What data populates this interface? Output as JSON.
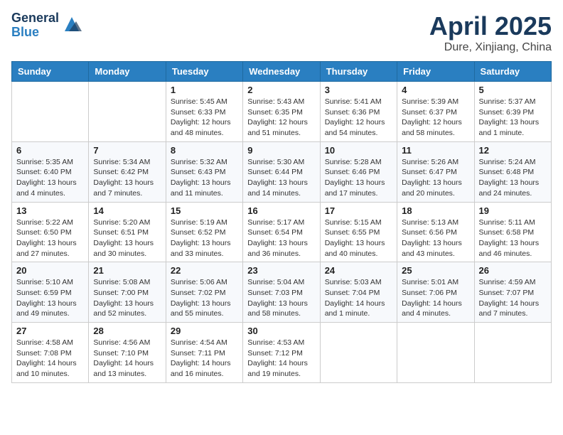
{
  "logo": {
    "general": "General",
    "blue": "Blue"
  },
  "title": "April 2025",
  "location": "Dure, Xinjiang, China",
  "days_of_week": [
    "Sunday",
    "Monday",
    "Tuesday",
    "Wednesday",
    "Thursday",
    "Friday",
    "Saturday"
  ],
  "weeks": [
    [
      {
        "day": "",
        "info": ""
      },
      {
        "day": "",
        "info": ""
      },
      {
        "day": "1",
        "info": "Sunrise: 5:45 AM\nSunset: 6:33 PM\nDaylight: 12 hours and 48 minutes."
      },
      {
        "day": "2",
        "info": "Sunrise: 5:43 AM\nSunset: 6:35 PM\nDaylight: 12 hours and 51 minutes."
      },
      {
        "day": "3",
        "info": "Sunrise: 5:41 AM\nSunset: 6:36 PM\nDaylight: 12 hours and 54 minutes."
      },
      {
        "day": "4",
        "info": "Sunrise: 5:39 AM\nSunset: 6:37 PM\nDaylight: 12 hours and 58 minutes."
      },
      {
        "day": "5",
        "info": "Sunrise: 5:37 AM\nSunset: 6:39 PM\nDaylight: 13 hours and 1 minute."
      }
    ],
    [
      {
        "day": "6",
        "info": "Sunrise: 5:35 AM\nSunset: 6:40 PM\nDaylight: 13 hours and 4 minutes."
      },
      {
        "day": "7",
        "info": "Sunrise: 5:34 AM\nSunset: 6:42 PM\nDaylight: 13 hours and 7 minutes."
      },
      {
        "day": "8",
        "info": "Sunrise: 5:32 AM\nSunset: 6:43 PM\nDaylight: 13 hours and 11 minutes."
      },
      {
        "day": "9",
        "info": "Sunrise: 5:30 AM\nSunset: 6:44 PM\nDaylight: 13 hours and 14 minutes."
      },
      {
        "day": "10",
        "info": "Sunrise: 5:28 AM\nSunset: 6:46 PM\nDaylight: 13 hours and 17 minutes."
      },
      {
        "day": "11",
        "info": "Sunrise: 5:26 AM\nSunset: 6:47 PM\nDaylight: 13 hours and 20 minutes."
      },
      {
        "day": "12",
        "info": "Sunrise: 5:24 AM\nSunset: 6:48 PM\nDaylight: 13 hours and 24 minutes."
      }
    ],
    [
      {
        "day": "13",
        "info": "Sunrise: 5:22 AM\nSunset: 6:50 PM\nDaylight: 13 hours and 27 minutes."
      },
      {
        "day": "14",
        "info": "Sunrise: 5:20 AM\nSunset: 6:51 PM\nDaylight: 13 hours and 30 minutes."
      },
      {
        "day": "15",
        "info": "Sunrise: 5:19 AM\nSunset: 6:52 PM\nDaylight: 13 hours and 33 minutes."
      },
      {
        "day": "16",
        "info": "Sunrise: 5:17 AM\nSunset: 6:54 PM\nDaylight: 13 hours and 36 minutes."
      },
      {
        "day": "17",
        "info": "Sunrise: 5:15 AM\nSunset: 6:55 PM\nDaylight: 13 hours and 40 minutes."
      },
      {
        "day": "18",
        "info": "Sunrise: 5:13 AM\nSunset: 6:56 PM\nDaylight: 13 hours and 43 minutes."
      },
      {
        "day": "19",
        "info": "Sunrise: 5:11 AM\nSunset: 6:58 PM\nDaylight: 13 hours and 46 minutes."
      }
    ],
    [
      {
        "day": "20",
        "info": "Sunrise: 5:10 AM\nSunset: 6:59 PM\nDaylight: 13 hours and 49 minutes."
      },
      {
        "day": "21",
        "info": "Sunrise: 5:08 AM\nSunset: 7:00 PM\nDaylight: 13 hours and 52 minutes."
      },
      {
        "day": "22",
        "info": "Sunrise: 5:06 AM\nSunset: 7:02 PM\nDaylight: 13 hours and 55 minutes."
      },
      {
        "day": "23",
        "info": "Sunrise: 5:04 AM\nSunset: 7:03 PM\nDaylight: 13 hours and 58 minutes."
      },
      {
        "day": "24",
        "info": "Sunrise: 5:03 AM\nSunset: 7:04 PM\nDaylight: 14 hours and 1 minute."
      },
      {
        "day": "25",
        "info": "Sunrise: 5:01 AM\nSunset: 7:06 PM\nDaylight: 14 hours and 4 minutes."
      },
      {
        "day": "26",
        "info": "Sunrise: 4:59 AM\nSunset: 7:07 PM\nDaylight: 14 hours and 7 minutes."
      }
    ],
    [
      {
        "day": "27",
        "info": "Sunrise: 4:58 AM\nSunset: 7:08 PM\nDaylight: 14 hours and 10 minutes."
      },
      {
        "day": "28",
        "info": "Sunrise: 4:56 AM\nSunset: 7:10 PM\nDaylight: 14 hours and 13 minutes."
      },
      {
        "day": "29",
        "info": "Sunrise: 4:54 AM\nSunset: 7:11 PM\nDaylight: 14 hours and 16 minutes."
      },
      {
        "day": "30",
        "info": "Sunrise: 4:53 AM\nSunset: 7:12 PM\nDaylight: 14 hours and 19 minutes."
      },
      {
        "day": "",
        "info": ""
      },
      {
        "day": "",
        "info": ""
      },
      {
        "day": "",
        "info": ""
      }
    ]
  ]
}
